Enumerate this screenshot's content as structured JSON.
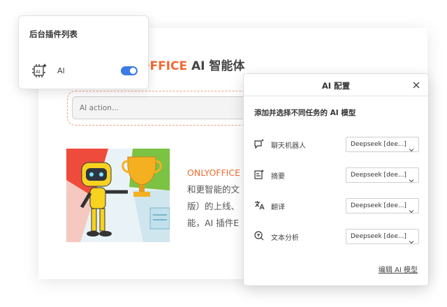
{
  "document": {
    "title_brand": "OFFICE",
    "title_rest": " AI 智能体",
    "ai_action_placeholder": "AI action...",
    "promo_lines": [
      "ONLYOFFICE",
      "和更智能的文",
      "版）的上线、",
      "能，AI 插件E"
    ]
  },
  "plugin_panel": {
    "title": "后台插件列表",
    "plugins": [
      {
        "name": "AI",
        "enabled": true,
        "icon": "ai-chip-icon"
      }
    ]
  },
  "dialog": {
    "title": "AI 配置",
    "subtitle": "添加并选择不同任务的 AI 模型",
    "tasks": [
      {
        "label": "聊天机器人",
        "icon": "chat-sparkle-icon",
        "model": "Deepseek [dee...]"
      },
      {
        "label": "摘要",
        "icon": "summary-icon",
        "model": "Deepseek [dee...]"
      },
      {
        "label": "翻译",
        "icon": "translate-icon",
        "model": "Deepseek [dee...]"
      },
      {
        "label": "文本分析",
        "icon": "text-analysis-icon",
        "model": "Deepseek [dee...]"
      }
    ],
    "edit_link": "编辑 AI 模型"
  },
  "colors": {
    "brand_orange": "#f26a32",
    "toggle_blue": "#3d7be3"
  }
}
